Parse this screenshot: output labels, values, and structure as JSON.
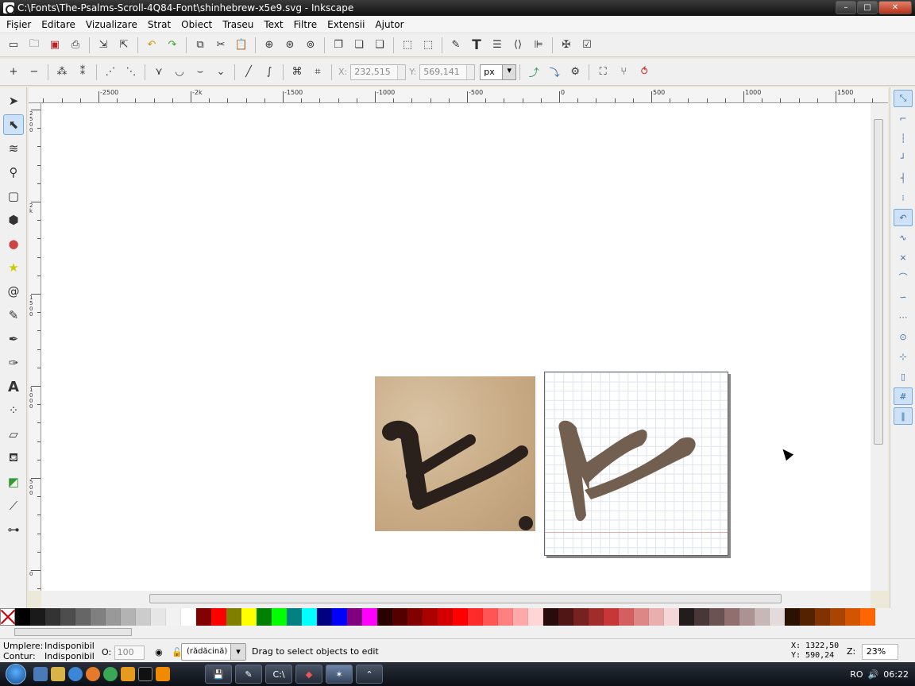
{
  "window": {
    "title": "C:\\Fonts\\The-Psalms-Scroll-4Q84-Font\\shinhebrew-x5e9.svg - Inkscape",
    "min": "–",
    "max": "□",
    "close": "✕"
  },
  "menu": [
    "Fișier",
    "Editare",
    "Vizualizare",
    "Strat",
    "Obiect",
    "Traseu",
    "Text",
    "Filtre",
    "Extensii",
    "Ajutor"
  ],
  "controls": {
    "x_label": "X:",
    "x_value": "232,515",
    "y_label": "Y:",
    "y_value": "569,141",
    "unit": "px"
  },
  "ruler_h": [
    "-2500",
    "-2k",
    "-1500",
    "-1000",
    "-500",
    "0",
    "500",
    "1000",
    "1500"
  ],
  "ruler_v": [
    "2500",
    "2k",
    "1500",
    "1000",
    "500",
    "0"
  ],
  "palette": [
    "#000000",
    "#1a1a1a",
    "#333333",
    "#4d4d4d",
    "#666666",
    "#808080",
    "#999999",
    "#b3b3b3",
    "#cccccc",
    "#e6e6e6",
    "#f2f2f2",
    "#ffffff",
    "#800000",
    "#ff0000",
    "#808000",
    "#ffff00",
    "#008000",
    "#00ff00",
    "#008080",
    "#00ffff",
    "#000080",
    "#0000ff",
    "#800080",
    "#ff00ff",
    "#2b0000",
    "#550000",
    "#800000",
    "#aa0000",
    "#d40000",
    "#ff0000",
    "#ff2a2a",
    "#ff5555",
    "#ff8080",
    "#ffaaaa",
    "#ffd5d5",
    "#280b0b",
    "#501616",
    "#782121",
    "#a02c2c",
    "#c83737",
    "#d35f5f",
    "#de8787",
    "#e9afaf",
    "#f4d7d7",
    "#241c1c",
    "#483737",
    "#6c5353",
    "#916f6f",
    "#ac9393",
    "#c8b7b7",
    "#e3dbdb",
    "#2b1100",
    "#552200",
    "#803300",
    "#aa4400",
    "#d45500",
    "#ff6600"
  ],
  "status": {
    "fill_label": "Umplere:",
    "fill_value": "Indisponibil",
    "stroke_label": "Contur:",
    "stroke_value": "Indisponibil",
    "opacity_label": "O:",
    "opacity_value": "100",
    "layer": "(rădăcină)",
    "message": "Drag to select objects to edit",
    "cursor_x": "X: 1322,50",
    "cursor_y": "Y:  590,24",
    "zoom_label": "Z:",
    "zoom_value": "23%"
  },
  "taskbar": {
    "lang": "RO",
    "clock": "06:22"
  }
}
